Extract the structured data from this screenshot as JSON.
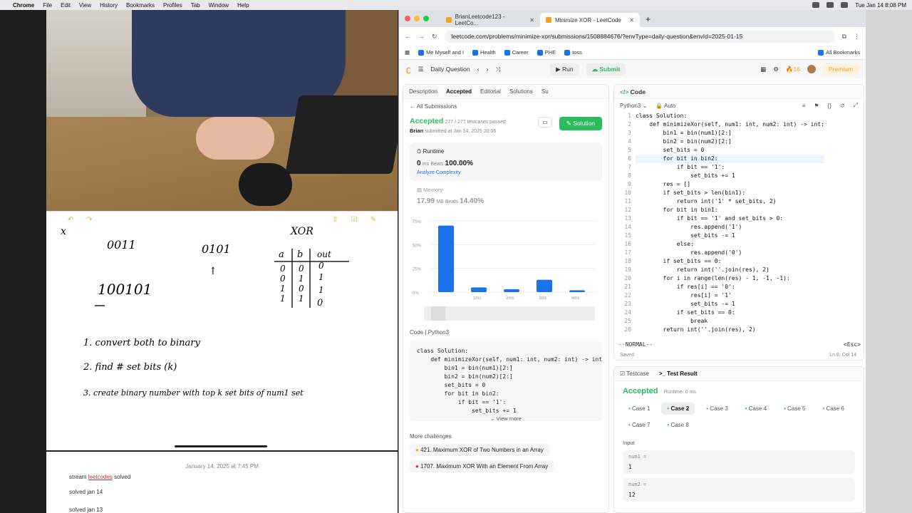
{
  "menubar": {
    "app": "Chrome",
    "items": [
      "File",
      "Edit",
      "View",
      "History",
      "Bookmarks",
      "Profiles",
      "Tab",
      "Window",
      "Help"
    ],
    "clock": "Tue Jan 14  8:08 PM"
  },
  "notes": {
    "xor_label": "XOR",
    "num_a": "0011",
    "num_b": "0101",
    "result": "100101",
    "truth_head": [
      "a",
      "b",
      "out"
    ],
    "truth_rows": [
      [
        "0",
        "0",
        "0"
      ],
      [
        "0",
        "1",
        "1"
      ],
      [
        "1",
        "0",
        "1"
      ],
      [
        "1",
        "1",
        "0"
      ]
    ],
    "step1": "1.   convert both to binary",
    "step2": "2.   find # set bits   (k)",
    "step3": "3.   create binary number with top k set bits of num1 set",
    "date": "January 14, 2025 at 7:45 PM",
    "line1_pre": "stream ",
    "line1_link": "leetcodes",
    "line1_post": " solved",
    "line2": "solved jan 14",
    "line3": "solved jan 13"
  },
  "browser": {
    "tab1": "BrianLeetcode123 - LeetCo...",
    "tab2": "Minimize XOR - LeetCode",
    "url": "leetcode.com/problems/minimize-xor/submissions/1508884676/?envType=daily-question&envId=2025-01-15",
    "bookmarks": [
      "Me Myself and I",
      "Health",
      "Career",
      "PHE",
      "toss"
    ],
    "all_bookmarks": "All Bookmarks"
  },
  "lcnav": {
    "daily": "Daily Question",
    "run": "Run",
    "submit": "Submit",
    "streak": "16",
    "premium": "Premium"
  },
  "left": {
    "tabs": [
      "Description",
      "Accepted",
      "Editorial",
      "Solutions",
      "Su"
    ],
    "all_submissions": "All Submissions",
    "status": "Accepted",
    "passed": "277 / 277 testcases passed",
    "author": "Brian",
    "submitted": "submitted at Jan 14, 2025 20:06",
    "solution_btn": "Solution",
    "runtime_label": "Runtime",
    "runtime_val": "0",
    "runtime_unit": "ms",
    "beats_label": "Beats",
    "runtime_beats": "100.00%",
    "analyze": "Analyze Complexity",
    "memory_label": "Memory",
    "memory_val": "17.99",
    "memory_unit": "MB",
    "memory_beats": "14.40%",
    "code_label": "Code",
    "code_lang": "Python3",
    "code_preview": [
      "class Solution:",
      "    def minimizeXor(self, num1: int, num2: int) -> int",
      "        bin1 = bin(num1)[2:]",
      "        bin2 = bin(num2)[2:]",
      "        set_bits = 0",
      "        for bit in bin2:",
      "            if bit == '1':",
      "                set_bits += 1"
    ],
    "view_more": "View more",
    "more_challenges": "More challenges",
    "challenge1": "421. Maximum XOR of Two Numbers in an Array",
    "challenge2": "1707. Maximum XOR With an Element From Array"
  },
  "chart_data": {
    "type": "bar",
    "categories": [
      "0ms",
      "1ms",
      "2ms",
      "3ms",
      "4ms"
    ],
    "values": [
      70,
      5,
      3,
      13,
      2
    ],
    "ylabel": "",
    "yticks": [
      "75%",
      "50%",
      "25%",
      "0%"
    ],
    "ylim": [
      0,
      75
    ],
    "color": "#1a73e8"
  },
  "code_panel": {
    "title": "Code",
    "lang": "Python3",
    "auto": "Auto",
    "lines": [
      "class Solution:",
      "    def minimizeXor(self, num1: int, num2: int) -> int:",
      "        bin1 = bin(num1)[2:]",
      "        bin2 = bin(num2)[2:]",
      "        set_bits = 0",
      "        for bit in bin2:",
      "            if bit == '1':",
      "                set_bits += 1",
      "        res = []",
      "        if set_bits > len(bin1):",
      "            return int('1' * set_bits, 2)",
      "        for bit in bin1:",
      "            if bit == '1' and set_bits > 0:",
      "                res.append('1')",
      "                set_bits -= 1",
      "            else:",
      "                res.append('0')",
      "        if set_bits == 0:",
      "            return int(''.join(res), 2)",
      "        for i in range(len(res) - 1, -1, -1):",
      "            if res[i] == '0':",
      "                res[i] = '1'",
      "                set_bits -= 1",
      "            if set_bits == 0:",
      "                break",
      "        return int(''.join(res), 2)"
    ],
    "mode": "--NORMAL--",
    "esc": "<Esc>",
    "saved": "Saved",
    "lncol": "Ln 6, Col 14"
  },
  "test": {
    "tab1": "Testcase",
    "tab2": "Test Result",
    "status": "Accepted",
    "runtime": "Runtime: 0 ms",
    "cases": [
      "Case 1",
      "Case 2",
      "Case 3",
      "Case 4",
      "Case 5",
      "Case 6",
      "Case 7",
      "Case 8"
    ],
    "input_label": "Input",
    "num1_label": "num1 =",
    "num1_val": "1",
    "num2_label": "num2 =",
    "num2_val": "12"
  },
  "colors": {
    "accent": "#2cbb5d",
    "brand": "#ffa116",
    "link": "#1a73e8"
  }
}
